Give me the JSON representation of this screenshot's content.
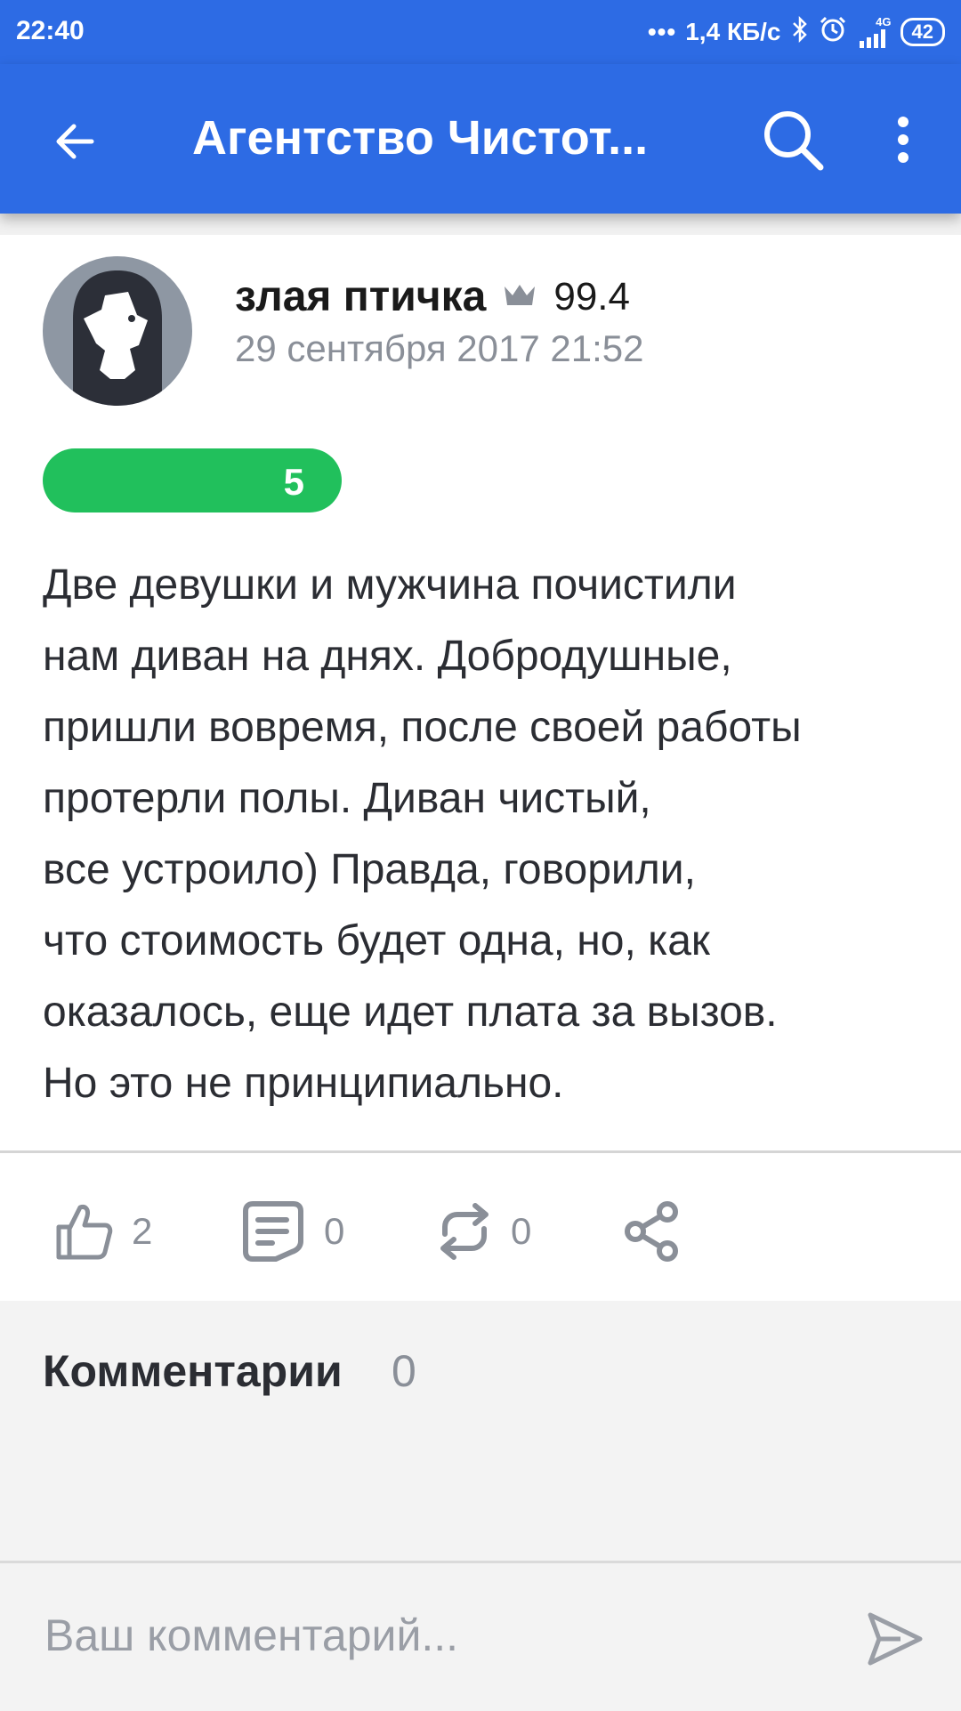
{
  "status_bar": {
    "time": "22:40",
    "network_speed": "1,4 КБ/с",
    "network_type": "4G",
    "battery": "42"
  },
  "app_bar": {
    "title": "Агентство Чистот..."
  },
  "review": {
    "author": "злая птичка",
    "author_score": "99.4",
    "date": "29 сентября 2017 21:52",
    "rating": "5",
    "rating_fraction": 1.0,
    "rating_color": "#21c05c",
    "text": "Две девушки и мужчина почистили\nнам диван на днях. Добродушные,\nпришли вовремя, после своей работы\nпротерли полы. Диван чистый,\nвсе устроило) Правда, говорили,\nчто стоимость будет одна, но, как\nоказалось, еще идет плата за вызов.\nНо это не принципиально."
  },
  "actions": {
    "likes": "2",
    "comments": "0",
    "reposts": "0"
  },
  "comments": {
    "title": "Комментарии",
    "count": "0",
    "input_placeholder": "Ваш комментарий..."
  },
  "colors": {
    "primary": "#2d6be4",
    "rating_green": "#21c05c",
    "muted": "#8a8f98"
  },
  "icons": [
    "back-arrow-icon",
    "search-icon",
    "more-vert-icon",
    "crown-icon",
    "thumbs-up-icon",
    "comment-icon",
    "repost-icon",
    "share-icon",
    "send-icon",
    "bluetooth-icon",
    "alarm-icon",
    "signal-icon",
    "battery-icon"
  ]
}
